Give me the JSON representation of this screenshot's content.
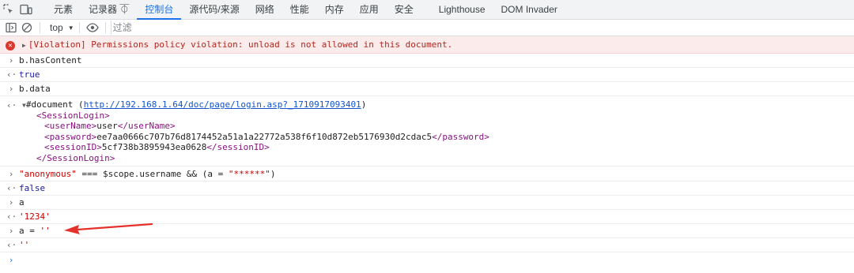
{
  "tabs": [
    "元素",
    "记录器 ⏁",
    "控制台",
    "源代码/来源",
    "网络",
    "性能",
    "内存",
    "应用",
    "安全",
    "Lighthouse",
    "DOM Invader"
  ],
  "toolbar": {
    "context": "top",
    "filter_placeholder": "过滤"
  },
  "console": {
    "violation": "[Violation] Permissions policy violation: unload is not allowed in this document.",
    "r1_in": "b.hasContent",
    "r1_out": "true",
    "r2_in": "b.data",
    "doc_prefix": "#document (",
    "doc_link": "http://192.168.1.64/doc/page/login.asp?_1710917093401",
    "doc_suffix": ")",
    "xml": {
      "session_open": "<SessionLogin>",
      "username_open": "<userName>",
      "username_value": "user",
      "username_close": "</userName>",
      "password_open": "<password>",
      "password_value": "ee7aa0666c707b76d8174452a51a1a22772a538f6f10d872eb5176930d2cdac5",
      "password_close": "</password>",
      "sessionid_open": "<sessionID>",
      "sessionid_value": "5cf738b3895943ea0628",
      "sessionid_close": "</sessionID>",
      "session_close": "</SessionLogin>"
    },
    "r3_str1": "\"anonymous\"",
    "r3_mid": " === $scope.username && (a = ",
    "r3_str2": "\"******\"",
    "r3_end": ")",
    "r3_out": "false",
    "r4_in": "a",
    "r4_out": "'1234'",
    "r5_in_prefix": "a = ",
    "r5_in_str": "''",
    "r5_out": "''"
  }
}
